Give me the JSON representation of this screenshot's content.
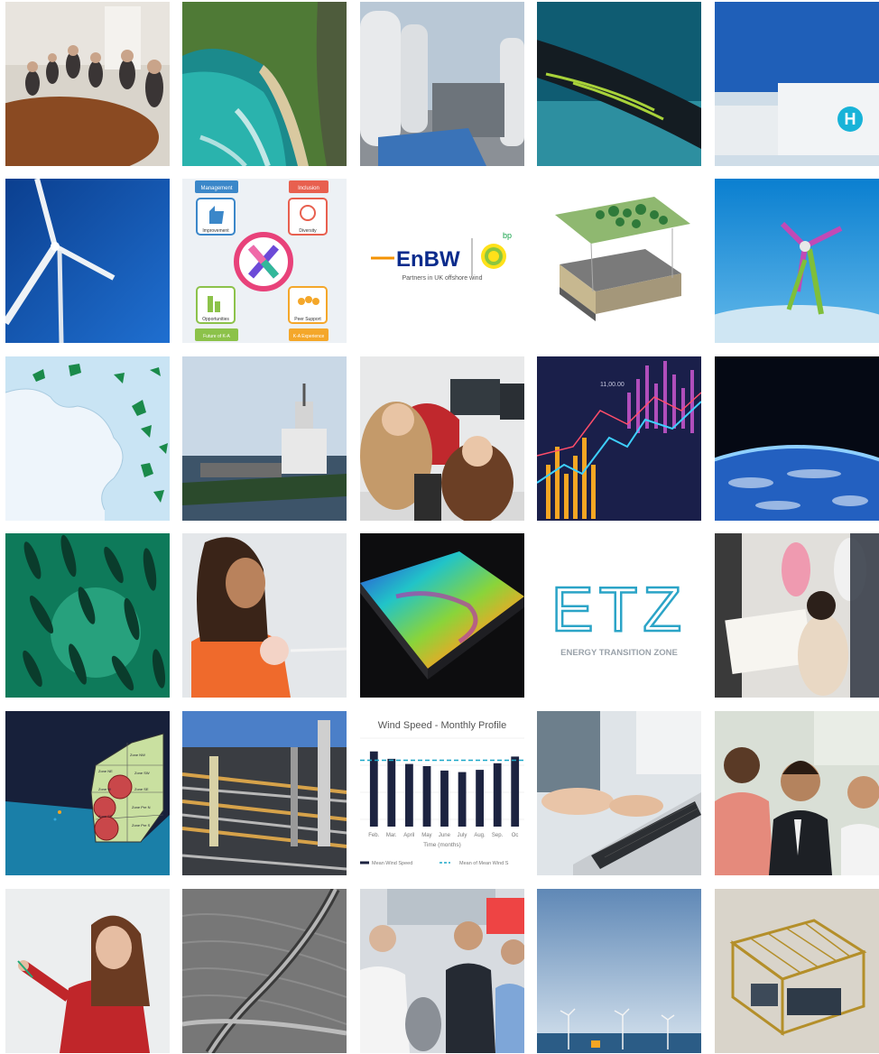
{
  "tiles": [
    {
      "name": "meeting-room-photo"
    },
    {
      "name": "coastline-aerial-photo"
    },
    {
      "name": "hydrogen-tanks-photo"
    },
    {
      "name": "subsea-cable-photo"
    },
    {
      "name": "hydrogen-containers-photo"
    },
    {
      "name": "wind-turbine-sky-photo"
    },
    {
      "name": "workforce-infographic",
      "labels": {
        "management": "Management",
        "inclusion": "Inclusion",
        "improvement": "Improvement",
        "diversity": "Diversity",
        "opportunities": "Opportunities",
        "peer_support": "Peer Support",
        "future": "Future of K-A",
        "k_a": "K-A Experience"
      }
    },
    {
      "name": "enbw-bp-logo",
      "enbw": "EnBW",
      "bp": "bp",
      "caption": "Partners in UK offshore wind"
    },
    {
      "name": "seabed-layers-diagram"
    },
    {
      "name": "tidal-turbine-render"
    },
    {
      "name": "scotland-wind-map"
    },
    {
      "name": "offshore-vessel-photo"
    },
    {
      "name": "office-colleagues-photo"
    },
    {
      "name": "financial-chart-photo",
      "label": "11,00.00"
    },
    {
      "name": "earth-from-space-photo"
    },
    {
      "name": "fish-shoal-photo"
    },
    {
      "name": "smiling-woman-photo"
    },
    {
      "name": "terrain-heatmap-render"
    },
    {
      "name": "etz-logo",
      "logo_text": "ETZ",
      "caption": "ENERGY TRANSITION ZONE"
    },
    {
      "name": "workshop-photo"
    },
    {
      "name": "wind-zone-map",
      "zones": [
        "Zone NW",
        "Zone NE",
        "Zone W",
        "Zone SE",
        "Zone SW",
        "Zone Pre N",
        "Zone Pre S",
        "Zone SS"
      ]
    },
    {
      "name": "refinery-pipes-photo"
    },
    {
      "name": "wind-speed-chart"
    },
    {
      "name": "laptop-typing-photo"
    },
    {
      "name": "men-listening-photo"
    },
    {
      "name": "presenter-woman-photo"
    },
    {
      "name": "seabed-pipeline-render"
    },
    {
      "name": "conference-networking-photo"
    },
    {
      "name": "offshore-windfarm-photo"
    },
    {
      "name": "subsea-frame-render"
    }
  ],
  "chart_data": {
    "type": "bar",
    "title": "Wind Speed - Monthly Profile",
    "categories": [
      "Feb.",
      "Mar.",
      "April",
      "May",
      "June",
      "July",
      "Aug.",
      "Sep.",
      "Oc"
    ],
    "values": [
      10.2,
      9.2,
      8.5,
      8.2,
      7.6,
      7.4,
      7.7,
      8.6,
      9.5
    ],
    "mean_line": 9.0,
    "ylim": [
      0,
      12
    ],
    "xlabel": "Time (months)",
    "ylabel": "",
    "legend": [
      "Mean Wind Speed",
      "Mean of Mean Wind S"
    ],
    "legend_position": "bottom",
    "colors": {
      "bars": "#1c2340",
      "mean": "#1aa7c8"
    }
  }
}
